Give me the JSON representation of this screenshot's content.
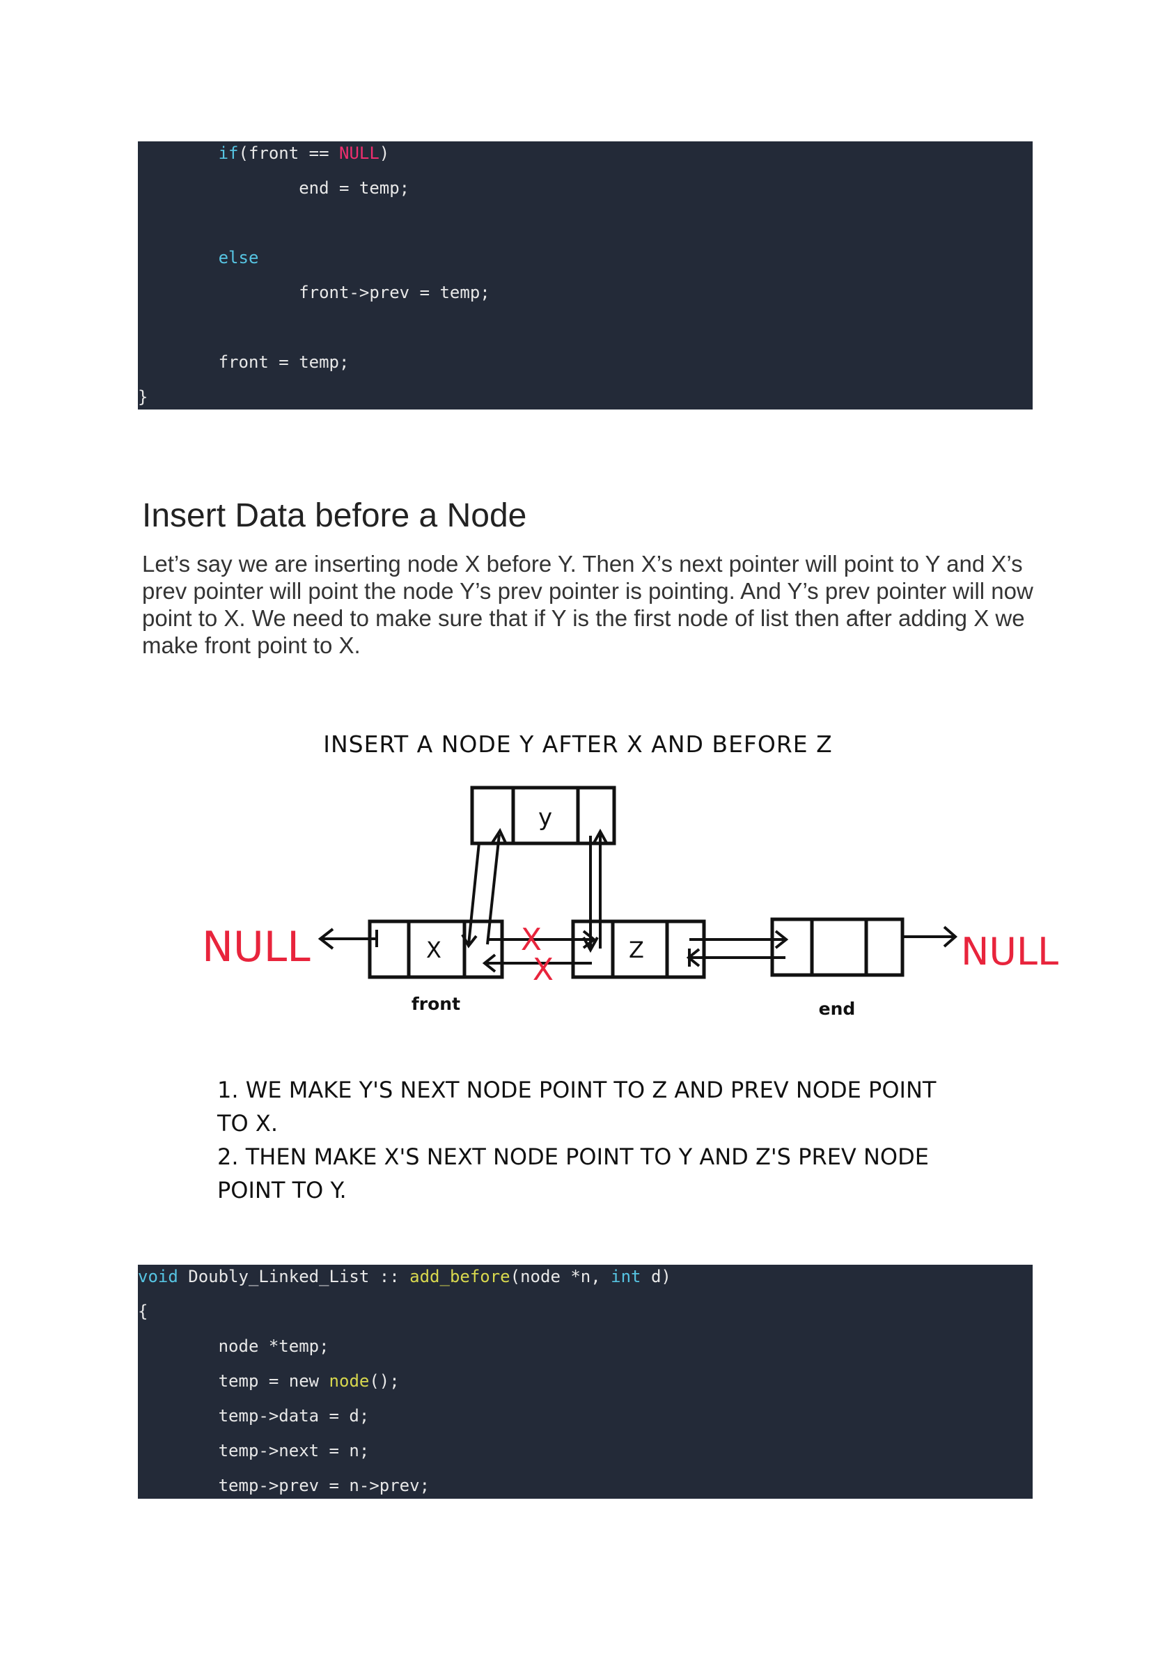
{
  "code_block_1": {
    "lines": [
      {
        "indent": "        ",
        "parts": [
          [
            "kw",
            "if"
          ],
          [
            "tx",
            "(front == "
          ],
          [
            "nl",
            "NULL"
          ],
          [
            "tx",
            ")"
          ]
        ]
      },
      {
        "indent": "                ",
        "parts": [
          [
            "tx",
            "end = temp;"
          ]
        ]
      },
      {
        "indent": "",
        "parts": []
      },
      {
        "indent": "        ",
        "parts": [
          [
            "kw",
            "else"
          ]
        ]
      },
      {
        "indent": "                ",
        "parts": [
          [
            "tx",
            "front->prev = temp;"
          ]
        ]
      },
      {
        "indent": "",
        "parts": []
      },
      {
        "indent": "        ",
        "parts": [
          [
            "tx",
            "front = temp;"
          ]
        ]
      },
      {
        "indent": "",
        "parts": [
          [
            "tx",
            "}"
          ]
        ]
      }
    ]
  },
  "section": {
    "title": "Insert Data before a Node",
    "paragraph": "Let’s say we are inserting node X before Y. Then X’s next pointer will point to Y and X’s prev pointer will point the node Y’s prev pointer is pointing. And Y’s prev pointer will now point to X. We need to make sure that if Y is the first node of list then after adding X we make front point to X."
  },
  "diagram": {
    "title": "INSERT A NODE Y AFTER X AND BEFORE Z",
    "null_left": "NULL",
    "null_right": "NULL",
    "node_y_label": "y",
    "node_x_label": "X",
    "node_z_label": "Z",
    "label_front": "front",
    "label_end": "end",
    "cross_mark": "X",
    "steps": [
      "1. WE MAKE Y'S NEXT NODE POINT TO Z AND PREV NODE POINT",
      "TO X.",
      "2. THEN MAKE X'S NEXT NODE POINT TO Y AND Z'S PREV NODE",
      "POINT TO Y."
    ],
    "colors": {
      "null": "#e8243c",
      "cross": "#e8243c",
      "ink": "#111111"
    }
  },
  "code_block_2": {
    "lines": [
      {
        "indent": "",
        "parts": [
          [
            "kw",
            "void"
          ],
          [
            "tx",
            " Doubly_Linked_List :: "
          ],
          [
            "fn",
            "add_before"
          ],
          [
            "tx",
            "(node *n, "
          ],
          [
            "kw",
            "int"
          ],
          [
            "tx",
            " d)"
          ]
        ]
      },
      {
        "indent": "",
        "parts": [
          [
            "tx",
            "{"
          ]
        ]
      },
      {
        "indent": "        ",
        "parts": [
          [
            "tx",
            "node *temp;"
          ]
        ]
      },
      {
        "indent": "        ",
        "parts": [
          [
            "tx",
            "temp = new "
          ],
          [
            "fn",
            "node"
          ],
          [
            "tx",
            "();"
          ]
        ]
      },
      {
        "indent": "        ",
        "parts": [
          [
            "tx",
            "temp->data = d;"
          ]
        ]
      },
      {
        "indent": "        ",
        "parts": [
          [
            "tx",
            "temp->next = n;"
          ]
        ]
      },
      {
        "indent": "        ",
        "parts": [
          [
            "tx",
            "temp->prev = n->prev;"
          ]
        ]
      }
    ]
  }
}
